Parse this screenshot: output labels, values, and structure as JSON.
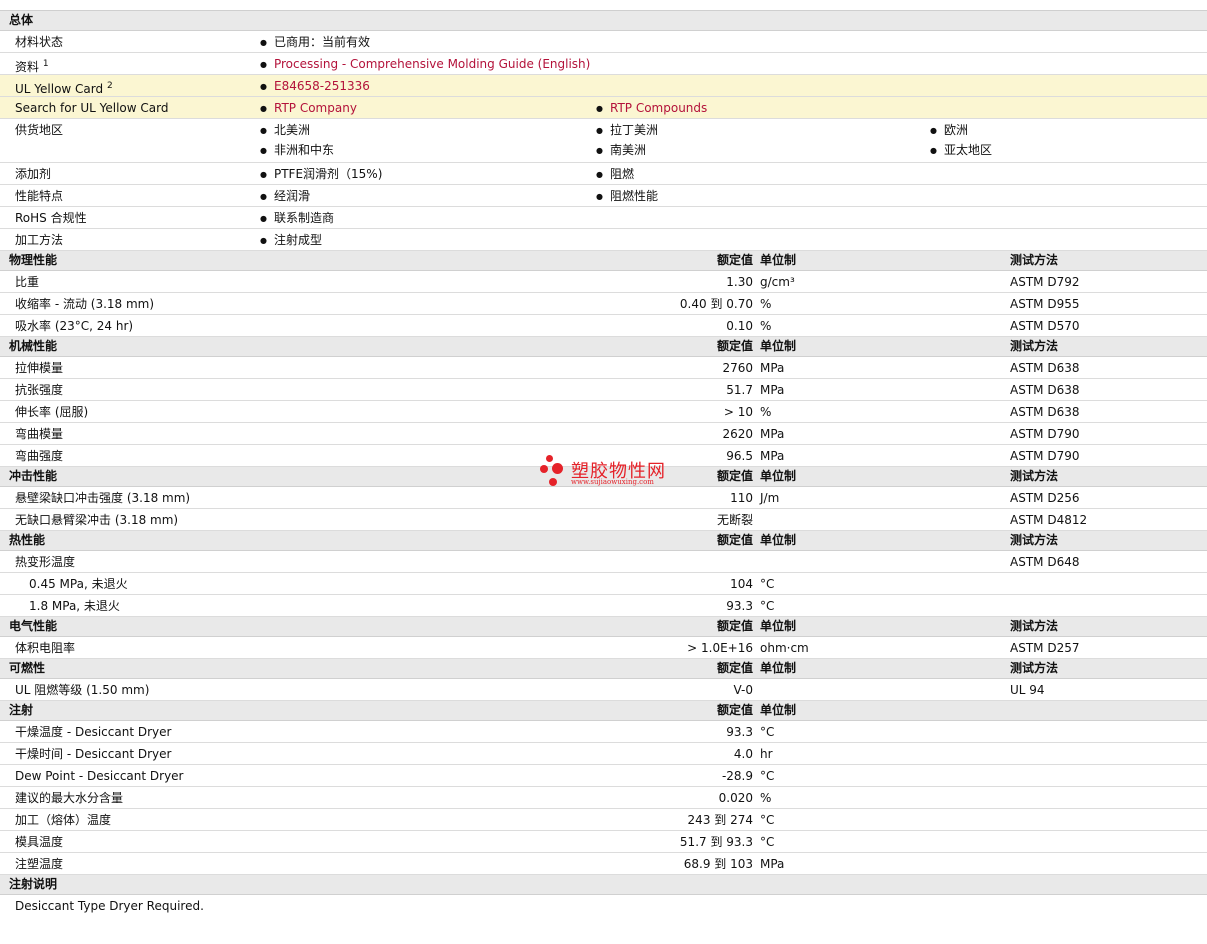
{
  "general": {
    "title": "总体",
    "material_status": {
      "label": "材料状态",
      "value": "已商用：当前有效"
    },
    "docs": {
      "label": "资料",
      "sup": "1",
      "link": "Processing - Comprehensive Molding Guide (English)"
    },
    "ul_card": {
      "label": "UL Yellow Card",
      "sup": "2",
      "link": "E84658-251336"
    },
    "ul_search": {
      "label": "Search for UL Yellow Card",
      "links": [
        "RTP Company",
        "RTP Compounds"
      ]
    },
    "regions": {
      "label": "供货地区",
      "items": [
        "北美洲",
        "拉丁美洲",
        "欧洲",
        "非洲和中东",
        "南美洲",
        "亚太地区"
      ]
    },
    "additive": {
      "label": "添加剂",
      "items": [
        "PTFE润滑剂（15%)",
        "阻燃"
      ]
    },
    "features": {
      "label": "性能特点",
      "items": [
        "经润滑",
        "阻燃性能"
      ]
    },
    "rohs": {
      "label": "RoHS 合规性",
      "items": [
        "联系制造商"
      ]
    },
    "processing": {
      "label": "加工方法",
      "items": [
        "注射成型"
      ]
    }
  },
  "headers": {
    "value": "额定值",
    "unit": "单位制",
    "test": "测试方法"
  },
  "physical": {
    "title": "物理性能",
    "rows": [
      {
        "label": "比重",
        "value": "1.30",
        "unit": "g/cm³",
        "test": "ASTM D792"
      },
      {
        "label": "收缩率  - 流动  (3.18 mm)",
        "value": "0.40 到  0.70",
        "unit": "%",
        "test": "ASTM D955"
      },
      {
        "label": "吸水率  (23°C, 24 hr)",
        "value": "0.10",
        "unit": "%",
        "test": "ASTM D570"
      }
    ]
  },
  "mechanical": {
    "title": "机械性能",
    "rows": [
      {
        "label": "拉伸模量",
        "value": "2760",
        "unit": "MPa",
        "test": "ASTM D638"
      },
      {
        "label": "抗张强度",
        "value": "51.7",
        "unit": "MPa",
        "test": "ASTM D638"
      },
      {
        "label": "伸长率  (屈服)",
        "value": "> 10",
        "unit": "%",
        "test": "ASTM D638"
      },
      {
        "label": "弯曲模量",
        "value": "2620",
        "unit": "MPa",
        "test": "ASTM D790"
      },
      {
        "label": "弯曲强度",
        "value": "96.5",
        "unit": "MPa",
        "test": "ASTM D790"
      }
    ]
  },
  "impact": {
    "title": "冲击性能",
    "rows": [
      {
        "label": "悬壁梁缺口冲击强度  (3.18 mm)",
        "value": "110",
        "unit": "J/m",
        "test": "ASTM D256"
      },
      {
        "label": "无缺口悬臂梁冲击  (3.18 mm)",
        "value": "无断裂",
        "unit": "",
        "test": "ASTM D4812"
      }
    ]
  },
  "thermal": {
    "title": "热性能",
    "rows": [
      {
        "label": "热变形温度",
        "value": "",
        "unit": "",
        "test": "ASTM D648"
      },
      {
        "label": "0.45 MPa, 未退火",
        "value": "104",
        "unit": "°C",
        "test": ""
      },
      {
        "label": "1.8 MPa, 未退火",
        "value": "93.3",
        "unit": "°C",
        "test": ""
      }
    ]
  },
  "electrical": {
    "title": "电气性能",
    "rows": [
      {
        "label": "体积电阻率",
        "value": "> 1.0E+16",
        "unit": "ohm·cm",
        "test": "ASTM D257"
      }
    ]
  },
  "flammability": {
    "title": "可燃性",
    "rows": [
      {
        "label": "UL 阻燃等级  (1.50 mm)",
        "value": "V-0",
        "unit": "",
        "test": "UL 94"
      }
    ]
  },
  "injection": {
    "title": "注射",
    "rows": [
      {
        "label": "干燥温度  - Desiccant Dryer",
        "value": "93.3",
        "unit": "°C"
      },
      {
        "label": "干燥时间  - Desiccant Dryer",
        "value": "4.0",
        "unit": "hr"
      },
      {
        "label": "Dew Point - Desiccant Dryer",
        "value": "-28.9",
        "unit": "°C"
      },
      {
        "label": "建议的最大水分含量",
        "value": "0.020",
        "unit": "%"
      },
      {
        "label": "加工（熔体）温度",
        "value": "243 到  274",
        "unit": "°C"
      },
      {
        "label": "模具温度",
        "value": "51.7 到  93.3",
        "unit": "°C"
      },
      {
        "label": "注塑温度",
        "value": "68.9 到  103",
        "unit": "MPa"
      }
    ]
  },
  "notes": {
    "title": "注射说明",
    "text": "Desiccant Type Dryer Required."
  },
  "watermark": {
    "name": "塑胶物性网",
    "url": "www.sujiaowuxing.com",
    "color": "#e52229"
  }
}
